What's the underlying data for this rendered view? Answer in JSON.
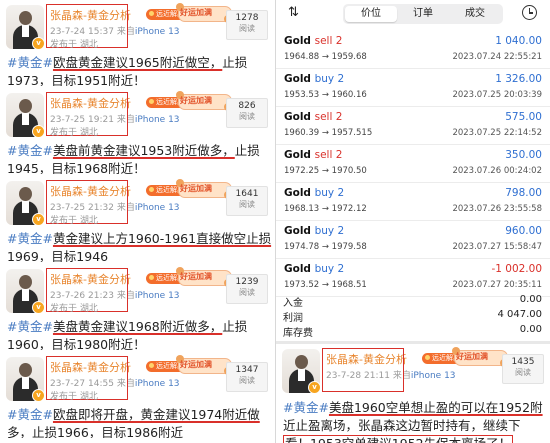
{
  "posts": [
    {
      "name": "张晶森-黄金分析",
      "vip": "远近解离",
      "date": "23-7-24 15:37",
      "from": "来自",
      "device": "iPhone 13",
      "location": "发布于 湖北",
      "reads": "1278",
      "reads_label": "阅读",
      "sticker": "好运加满",
      "tag": "#黄金#",
      "text_a": "欧盘黄金建议1965附近做空，",
      "text_b": "止损1973，目标1951附近！"
    },
    {
      "name": "张晶森-黄金分析",
      "vip": "远近解离",
      "date": "23-7-25 19:21",
      "from": "来自",
      "device": "iPhone 13",
      "location": "发布于 湖北",
      "reads": "826",
      "reads_label": "阅读",
      "sticker": "好运加满",
      "tag": "#黄金#",
      "text_a": "美盘前黄金建议1953附近做多，",
      "text_b": "止损1945，目标1968附近！"
    },
    {
      "name": "张晶森-黄金分析",
      "vip": "远近解离",
      "date": "23-7-25 21:32",
      "from": "来自",
      "device": "iPhone 13",
      "location": "发布于 湖北",
      "reads": "1641",
      "reads_label": "阅读",
      "sticker": "好运加满",
      "tag": "#黄金#",
      "text_a": "黄金建议上方1960-1961直接做空止损",
      "text_b": "1969，目标1946"
    },
    {
      "name": "张晶森-黄金分析",
      "vip": "远近解离",
      "date": "23-7-26 21:23",
      "from": "来自",
      "device": "iPhone 13",
      "location": "发布于 湖北",
      "reads": "1239",
      "reads_label": "阅读",
      "sticker": "好运加满",
      "tag": "#黄金#",
      "text_a": "美盘黄金建议1968附近做多，",
      "text_b": "止损1960，目标1980附近！"
    },
    {
      "name": "张晶森-黄金分析",
      "vip": "远近解离",
      "date": "23-7-27 14:55",
      "from": "来自",
      "device": "iPhone 13",
      "location": "发布于 湖北",
      "reads": "1347",
      "reads_label": "阅读",
      "sticker": "好运加满",
      "tag": "#黄金#",
      "text_a": "欧盘即将开盘，黄金建议1974附近做",
      "text_b": "多，止损1966，目标1986附近"
    }
  ],
  "post6": {
    "name": "张晶森-黄金分析",
    "vip": "远近解离",
    "date": "23-7-28 21:11",
    "from": "来自",
    "device": "iPhone 13",
    "reads": "1435",
    "reads_label": "阅读",
    "sticker": "好运加满",
    "tag": "#黄金#",
    "text_a": "美盘1960空单想止盈的可以在1952附",
    "text_b": "近止盈离场，张晶森这边暂时持有，继续下",
    "text_c": "看！1953空单建议1952先保本离场了！"
  },
  "toolbar": {
    "sort_icon": "sort-icon",
    "tabs": [
      "价位",
      "订单",
      "成交"
    ],
    "active_tab": 0,
    "clock_icon": "clock-icon"
  },
  "trades": [
    {
      "symbol": "Gold",
      "side": "sell 2",
      "type": "sell",
      "profit": "1 040.00",
      "price": "1964.88 → 1959.68",
      "time": "2023.07.24 22:55:21"
    },
    {
      "symbol": "Gold",
      "side": "buy 2",
      "type": "buy",
      "profit": "1 326.00",
      "price": "1953.53 → 1960.16",
      "time": "2023.07.25 20:03:39"
    },
    {
      "symbol": "Gold",
      "side": "sell 2",
      "type": "sell",
      "profit": "575.00",
      "price": "1960.39 → 1957.515",
      "time": "2023.07.25 22:14:52"
    },
    {
      "symbol": "Gold",
      "side": "sell 2",
      "type": "sell",
      "profit": "350.00",
      "price": "1972.25 → 1970.50",
      "time": "2023.07.26 00:24:02"
    },
    {
      "symbol": "Gold",
      "side": "buy 2",
      "type": "buy",
      "profit": "798.00",
      "price": "1968.13 → 1972.12",
      "time": "2023.07.26 23:55:58"
    },
    {
      "symbol": "Gold",
      "side": "buy 2",
      "type": "buy",
      "profit": "960.00",
      "price": "1974.78 → 1979.58",
      "time": "2023.07.27 15:58:47"
    },
    {
      "symbol": "Gold",
      "side": "buy 2",
      "type": "buy",
      "profit": "-1 002.00",
      "price": "1973.52 → 1968.51",
      "time": "2023.07.27 20:35:11"
    }
  ],
  "summary": [
    {
      "k": "入金",
      "v": "0.00"
    },
    {
      "k": "利润",
      "v": "4 047.00"
    },
    {
      "k": "库存费",
      "v": "0.00"
    }
  ]
}
